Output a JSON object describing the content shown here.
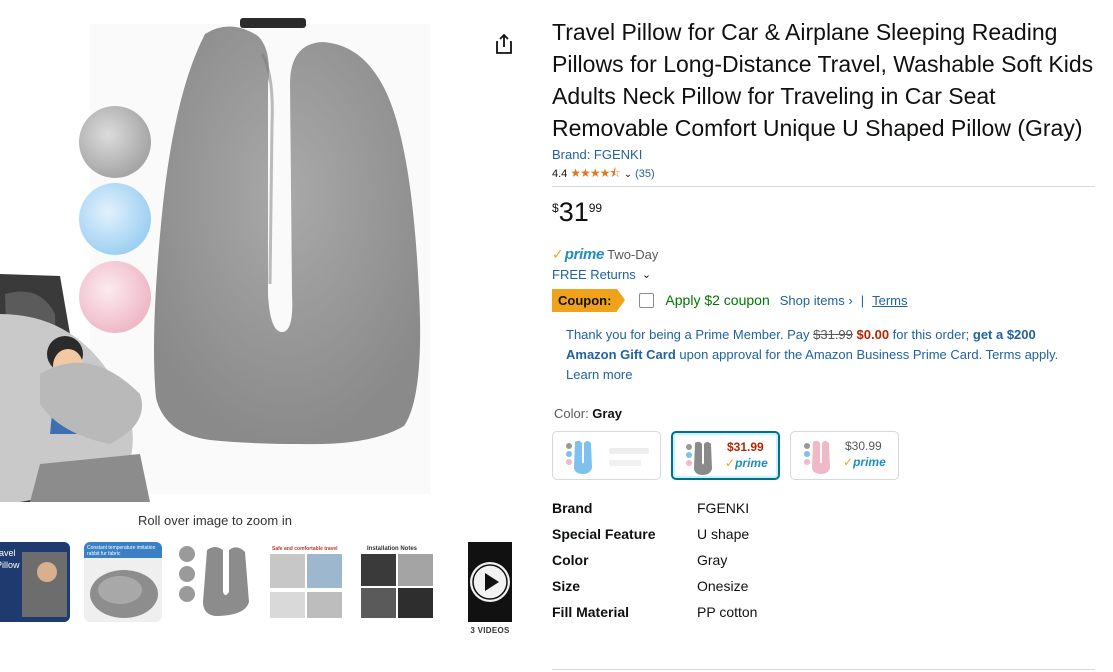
{
  "product": {
    "title": "Travel Pillow for Car & Airplane Sleeping Reading Pillows for Long-Distance Travel, Washable Soft Kids Adults Neck Pillow for Traveling in Car Seat Removable Comfort Unique U Shaped Pillow (Gray)",
    "brand_link": "Brand: FGENKI",
    "rating": "4.4",
    "stars": "★★★★⯪",
    "review_count": "(35)"
  },
  "price": {
    "symbol": "$",
    "whole": "31",
    "fraction": "99"
  },
  "delivery": {
    "prime_check": "✓",
    "prime_label": "prime",
    "prime_speed": "Two-Day",
    "free_returns": "FREE Returns"
  },
  "coupon": {
    "badge": "Coupon:",
    "apply_text": "Apply $2 coupon",
    "shop_items": "Shop items ›",
    "separator": "|",
    "terms": "Terms"
  },
  "prime_offer": {
    "part1": "Thank you for being a Prime Member. Pay ",
    "old_price": "$31.99",
    "new_price": "$0.00",
    "part2": " for this order; ",
    "bold": "get a $200 Amazon Gift Card",
    "part3": " upon approval for the Amazon Business Prime Card. ",
    "link": "Terms apply. Learn more"
  },
  "color": {
    "label": "Color: ",
    "value": "Gray",
    "swatches": [
      {
        "name": "Blue",
        "price": "",
        "prime": ""
      },
      {
        "name": "Gray",
        "price": "$31.99",
        "prime": "prime"
      },
      {
        "name": "Pink",
        "price": "$30.99",
        "prime": "prime"
      }
    ]
  },
  "specs": [
    {
      "key": "Brand",
      "value": "FGENKI"
    },
    {
      "key": "Special Feature",
      "value": "U shape"
    },
    {
      "key": "Color",
      "value": "Gray"
    },
    {
      "key": "Size",
      "value": "Onesize"
    },
    {
      "key": "Fill Material",
      "value": "PP cotton"
    }
  ],
  "gallery": {
    "zoom_hint": "Roll over image to zoom in",
    "videos_label": "3 VIDEOS",
    "thumb_texts": [
      "ravel Pillow",
      "Constant temperature imitation rabbit fur fabric",
      "Safe and comfortable travel",
      "Installation Notes"
    ]
  },
  "colors": {
    "link": "#2162a1",
    "price_red": "#b12704",
    "coupon_orange": "#f0a21a",
    "prime_blue": "#1f8ebf",
    "coupon_green": "#007600",
    "selected_border": "#007185"
  }
}
